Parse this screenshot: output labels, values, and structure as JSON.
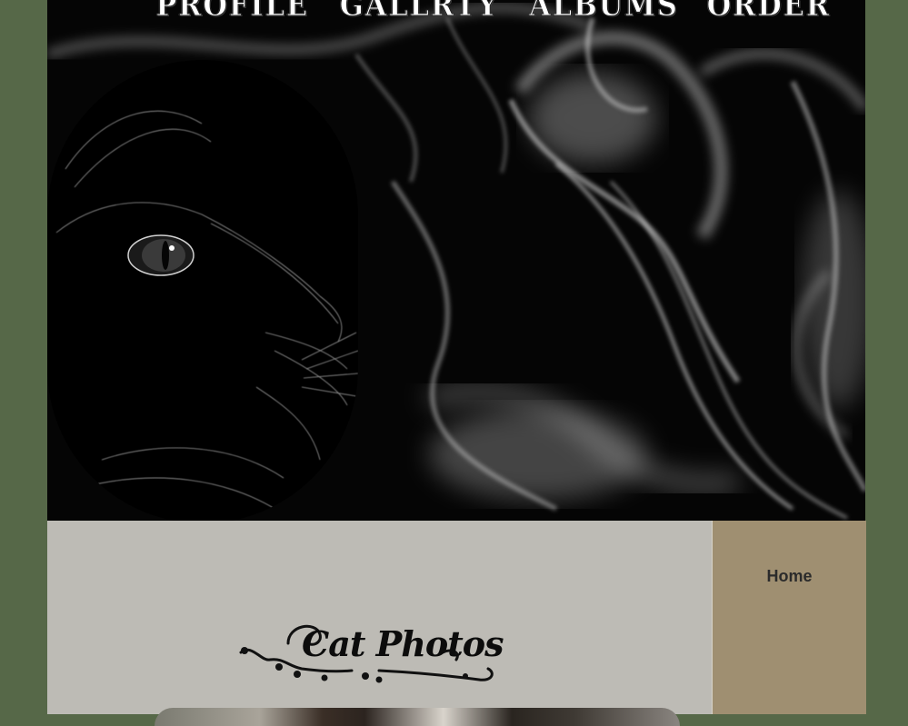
{
  "nav": {
    "items": [
      {
        "label": "PROFILE"
      },
      {
        "label": "GALLRTY"
      },
      {
        "label": "ALBUMS"
      },
      {
        "label": "ORDER"
      }
    ]
  },
  "hero": {
    "image": "black-cat-icon",
    "background": "smoke-icon"
  },
  "content": {
    "title": "Cat Photos"
  },
  "sidebar": {
    "home_label": "Home"
  },
  "colors": {
    "page_bg": "#566848",
    "content_bg": "#bdbbb5",
    "sidebar_bg": "#9f8f71"
  }
}
